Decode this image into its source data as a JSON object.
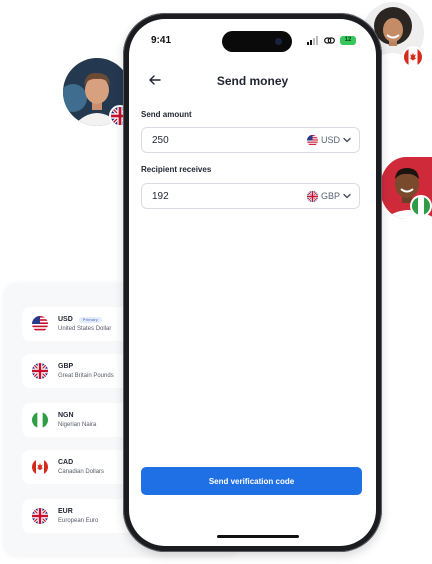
{
  "status_bar": {
    "time": "9:41",
    "battery": "12"
  },
  "header": {
    "title": "Send money"
  },
  "send": {
    "label": "Send amount",
    "amount": "250",
    "currency": "USD"
  },
  "receive": {
    "label": "Recipient receives",
    "amount": "192",
    "currency": "GBP"
  },
  "primary_button": {
    "label": "Send verification code"
  },
  "currencies": [
    {
      "code": "USD",
      "name": "United States Dollar",
      "badge": "Primary",
      "flag": "us-flag-icon"
    },
    {
      "code": "GBP",
      "name": "Great Britain Pounds",
      "flag": "uk-flag-icon"
    },
    {
      "code": "NGN",
      "name": "Nigerian Naira",
      "flag": "ng-flag-icon"
    },
    {
      "code": "CAD",
      "name": "Canadian Dollars",
      "flag": "ca-flag-icon"
    },
    {
      "code": "EUR",
      "name": "European Euro",
      "flag": "uk-flag-icon"
    }
  ],
  "colors": {
    "accent": "#1f6fe5",
    "battery": "#35c759",
    "badge_text": "#3a63c9",
    "badge_bg": "#e4ecfb"
  }
}
